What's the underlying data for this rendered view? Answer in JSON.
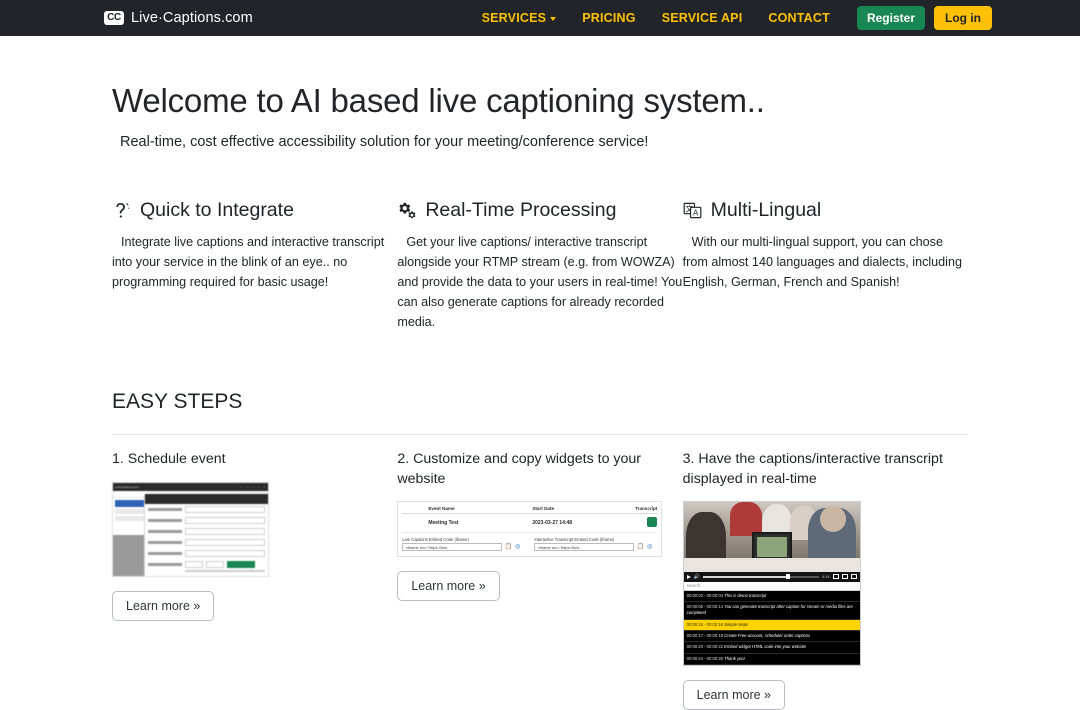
{
  "navbar": {
    "brand": "Live·Captions.com",
    "brand_badge": "CC",
    "links": [
      {
        "label": "SERVICES",
        "has_caret": true
      },
      {
        "label": "PRICING",
        "has_caret": false
      },
      {
        "label": "SERVICE API",
        "has_caret": false
      },
      {
        "label": "CONTACT",
        "has_caret": false
      }
    ],
    "register_label": "Register",
    "login_label": "Log in",
    "colors": {
      "background": "#212529",
      "link": "#ffc107",
      "register": "#198754",
      "login": "#ffc107"
    }
  },
  "hero": {
    "title": "Welcome to AI based live captioning system..",
    "subtitle": "Real-time, cost effective accessibility solution for your meeting/conference service!"
  },
  "features": [
    {
      "icon": "ear-hearing-icon",
      "glyph": "🦻",
      "title": "Quick to Integrate",
      "text": "Integrate live captions and interactive transcript into your service in the blink of an eye.. no programming required for basic usage!"
    },
    {
      "icon": "gears-icon",
      "glyph": "⚙",
      "title": "Real-Time Processing",
      "text": "Get your live captions/ interactive transcript alongside your RTMP stream (e.g. from WOWZA) and provide the data to your users in real-time! You can also generate captions for already recorded media."
    },
    {
      "icon": "translate-icon",
      "glyph": "🗚",
      "title": "Multi-Lingual",
      "text": "With our multi-lingual support, you can chose from almost 140 languages and dialects, including English, German, French and Spanish!"
    }
  ],
  "easy_steps": {
    "heading": "EASY STEPS",
    "learn_more_label": "Learn more »",
    "steps": [
      {
        "title": "1. Schedule event"
      },
      {
        "title": "2. Customize and copy widgets to your website"
      },
      {
        "title": "3. Have the captions/interactive transcript displayed in real-time"
      }
    ]
  },
  "thumb_schedule": {
    "window_title": "LiveCaptions.com",
    "modal_title": "Schedule Live Captions",
    "fields": [
      {
        "label": "Event Name",
        "value": "My test meeting"
      },
      {
        "label": "Event start date",
        "value": "2023-03-27 14:48"
      },
      {
        "label": "Event time zone",
        "value": "UTC+01:00 Berlin"
      },
      {
        "label": "Event language",
        "value": "English (United States)"
      },
      {
        "label": "Publishing URL",
        "value": "e.g. http://live-collection-appserver/liveStream/livestream/publish"
      },
      {
        "label": "Target Entry",
        "value": "Order"
      },
      {
        "label": "Perfectly prebuffer",
        "value": "0"
      },
      {
        "label": "Post stop time",
        "value": "600"
      }
    ],
    "target_entry_buttons": [
      "Order",
      "or Live feed",
      "Create Entry"
    ],
    "units": "seconds"
  },
  "thumb_widgets": {
    "columns": [
      "",
      "Event Name",
      "Start Date",
      "Transcript"
    ],
    "row": {
      "event_name": "Meeting Test",
      "start_date": "2023-03-27 14:48",
      "transcript_icon": "transcript-icon"
    },
    "embed_blocks": [
      {
        "label": "Live Captions Embed Code (iframe)",
        "value": "<iframe src=\"https://live-"
      },
      {
        "label": "Interactive Transcript Embed Code (iframe)",
        "value": "<iframe src=\"https://live-"
      }
    ]
  },
  "thumb_player": {
    "search_placeholder": "search..",
    "transcript": [
      {
        "time": "00:00:02 - 00:00:04",
        "text": "This is demo transcript",
        "highlight": false
      },
      {
        "time": "00:00:05 - 00:00:14",
        "text": "You can generate transcript after caption for stream or media files are completed",
        "highlight": false
      },
      {
        "time": "00:00:15 - 00:00:16",
        "text": "Simple steps",
        "highlight": true
      },
      {
        "time": "00:00:17 - 00:00:19",
        "text": "Create Free account, schedule/ order captions",
        "highlight": false
      },
      {
        "time": "00:00:20 - 00:00:22",
        "text": "Embed widget HTML code into your website",
        "highlight": false
      },
      {
        "time": "00:00:24 - 00:00:26",
        "text": "Thank you!",
        "highlight": false
      }
    ],
    "player_time": "4:14"
  }
}
